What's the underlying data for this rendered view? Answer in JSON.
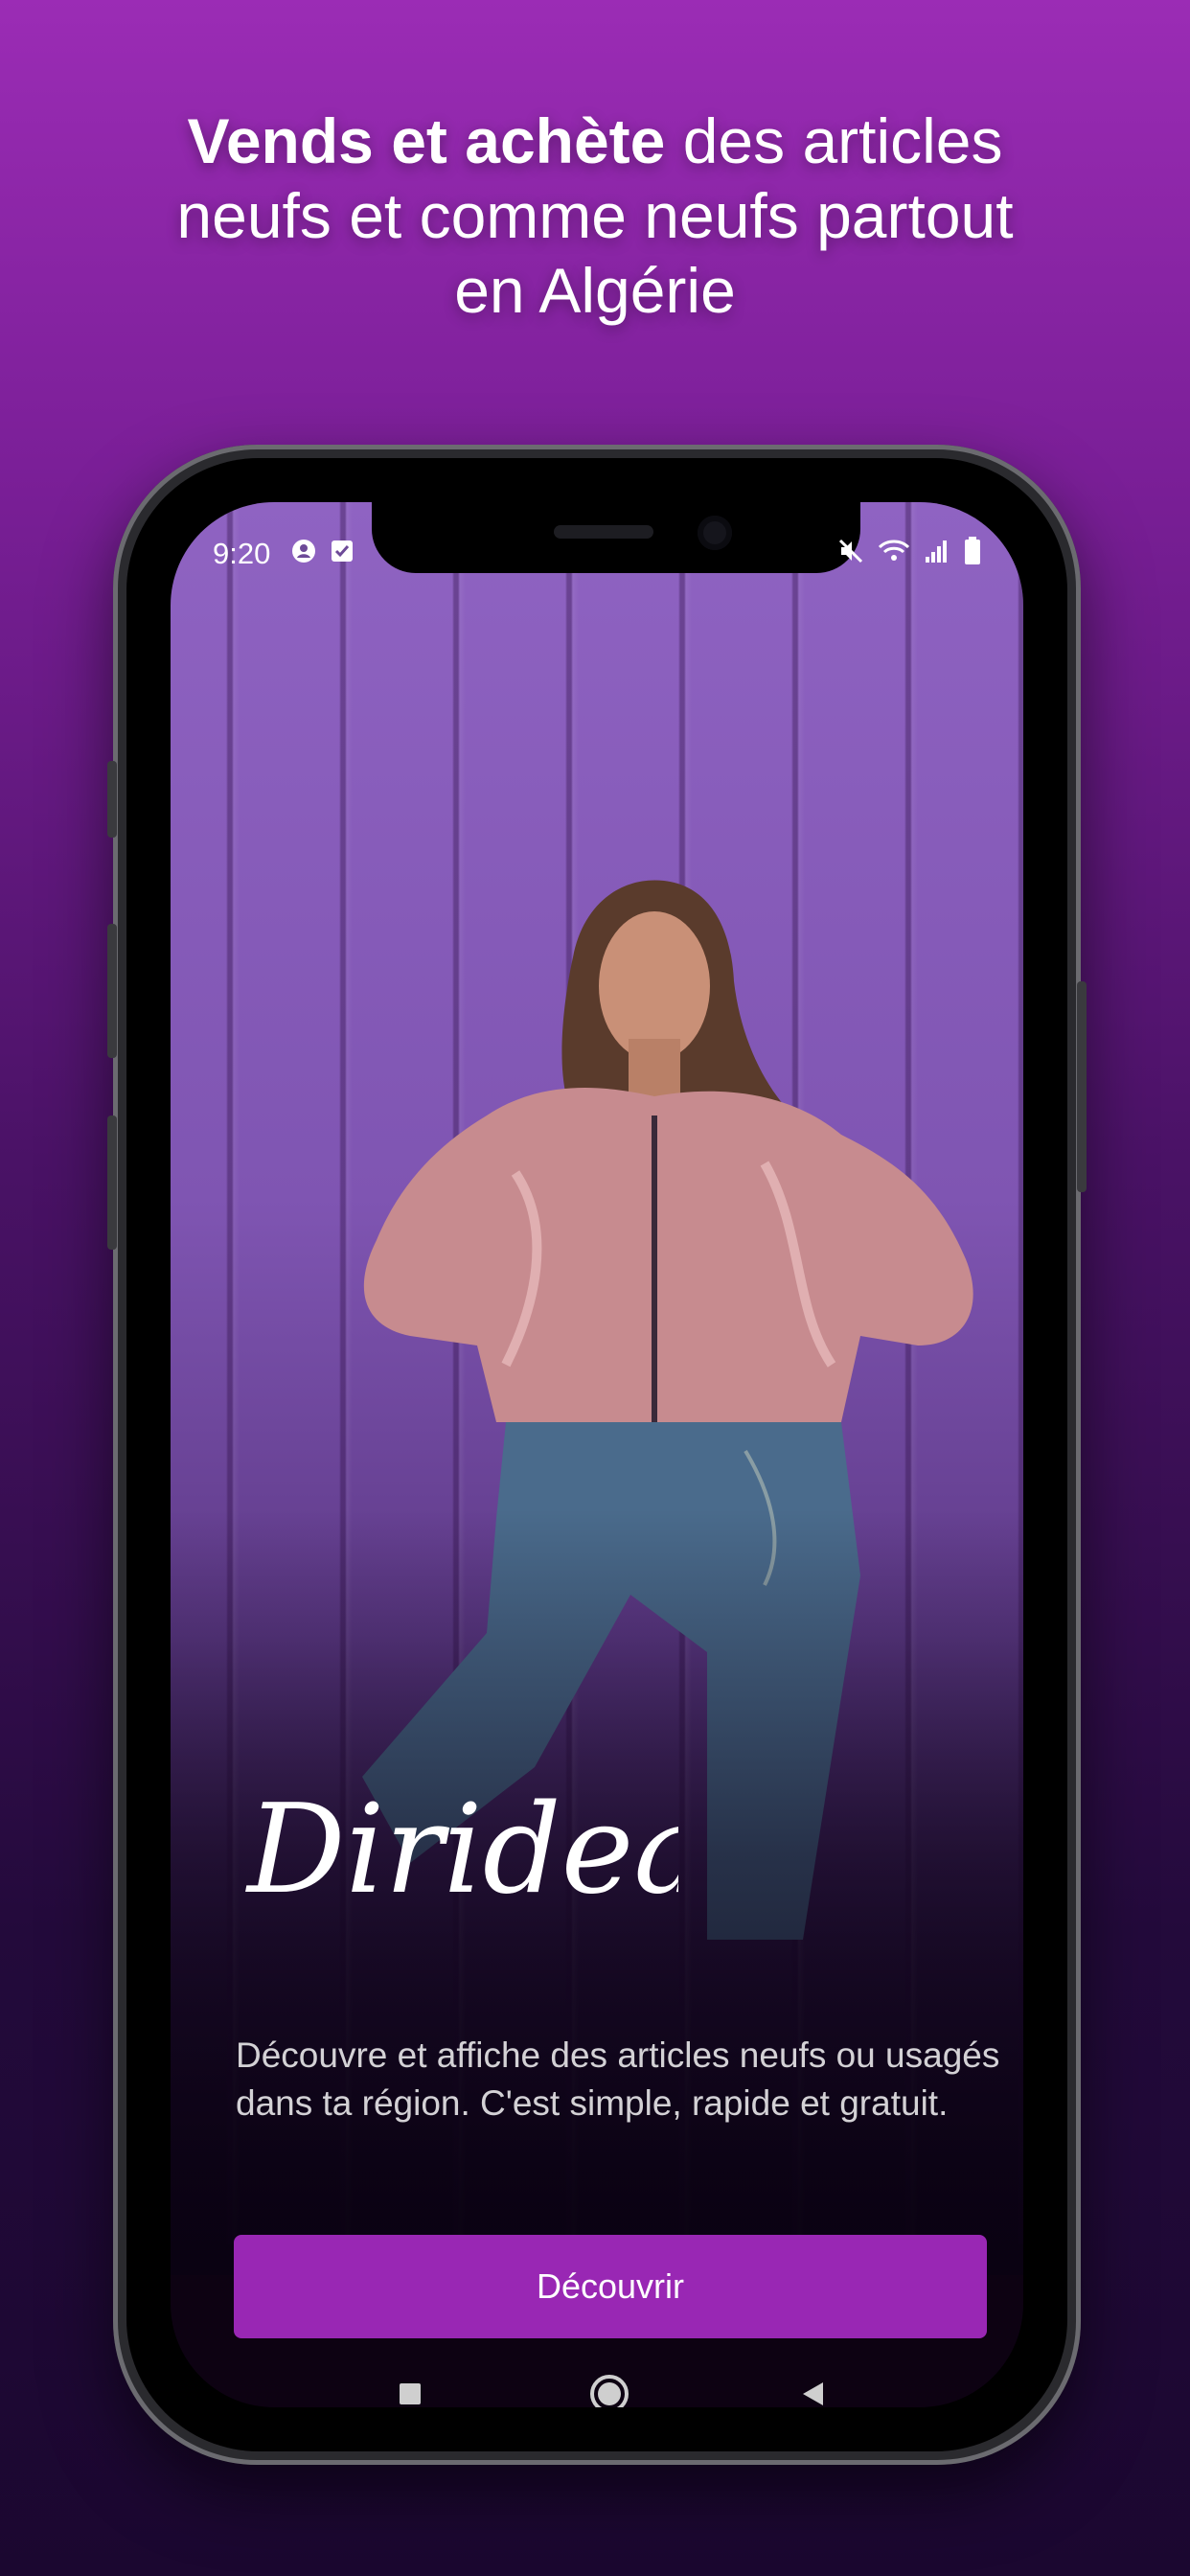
{
  "headline": {
    "bold_part": "Vends et achète",
    "line1_rest": " des articles",
    "line2": "neufs et comme neufs partout",
    "line3": "en Algérie"
  },
  "status_bar": {
    "time": "9:20",
    "left_icons": [
      "account-circle-icon",
      "checkbox-icon"
    ],
    "right_icons": [
      "mute-vibrate-icon",
      "wifi-icon",
      "signal-icon",
      "battery-icon"
    ]
  },
  "app": {
    "logo_text": "Dirideal",
    "description": "Découvre et affiche des articles neufs ou usagés dans ta région. C'est simple, rapide et gratuit.",
    "cta_label": "Découvrir"
  },
  "nav_bar": {
    "items": [
      "recents-square-icon",
      "home-circle-icon",
      "back-triangle-icon"
    ]
  },
  "colors": {
    "accent": "#9927b4",
    "background_top": "#9b2cb5",
    "background_bottom": "#1b0730"
  }
}
